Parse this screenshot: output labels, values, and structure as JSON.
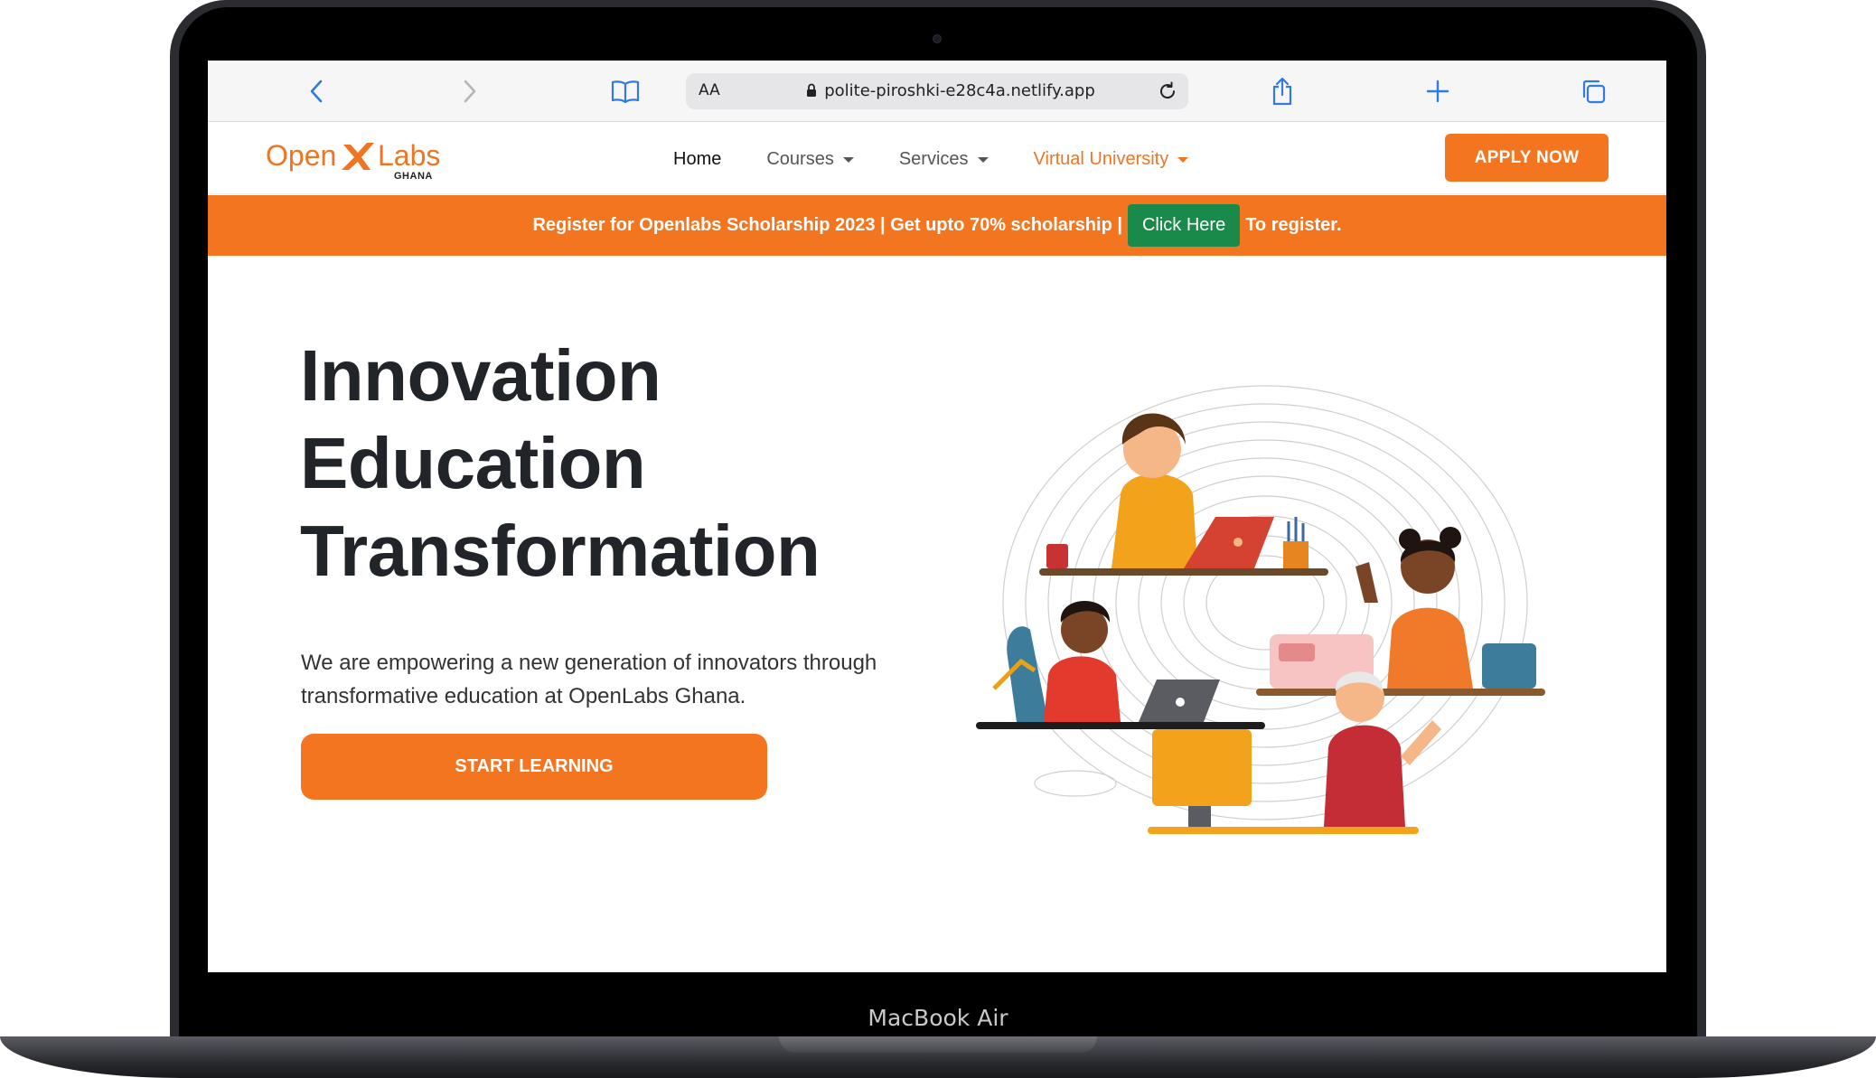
{
  "device": {
    "label": "MacBook Air"
  },
  "browser": {
    "url_display": "polite-piroshki-e28c4a.netlify.app",
    "text_size_label": "AA",
    "icons": [
      "chevron-left-icon",
      "chevron-right-icon",
      "book-icon",
      "lock-icon",
      "reload-icon",
      "share-icon",
      "plus-icon",
      "tabs-icon"
    ]
  },
  "navbar": {
    "logo": {
      "word1": "Open",
      "word2": "Labs",
      "sub": "GHANA"
    },
    "links": [
      {
        "label": "Home",
        "has_dropdown": false
      },
      {
        "label": "Courses",
        "has_dropdown": true
      },
      {
        "label": "Services",
        "has_dropdown": true
      },
      {
        "label": "Virtual University",
        "has_dropdown": true
      }
    ],
    "apply_label": "APPLY NOW"
  },
  "banner": {
    "text_before": "Register for Openlabs Scholarship 2023 | Get upto 70% scholarship |",
    "button_label": "Click Here",
    "text_after": "To register."
  },
  "hero": {
    "title_lines": [
      "Innovation",
      "Education",
      "Transformation"
    ],
    "subtitle_line1": "We are empowering a new generation of innovators through",
    "subtitle_line2": "transformative education at OpenLabs Ghana.",
    "cta_label": "START LEARNING"
  },
  "colors": {
    "accent": "#f47520",
    "banner_button": "#1a8a4a",
    "title_text": "#212429"
  }
}
